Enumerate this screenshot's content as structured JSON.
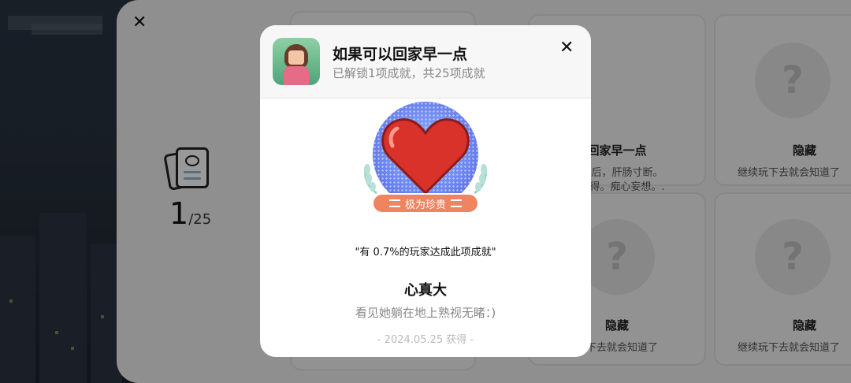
{
  "summary": {
    "unlocked": "1",
    "total": "/25"
  },
  "background_cards": [
    {
      "title": "回家早一点",
      "desc": "落花后，肝肠寸断。",
      "desc2": "求不得。痴心妄想。.",
      "tag": "极为珍贵"
    },
    {
      "title": "隐藏",
      "desc": "继续玩下去就会知道了"
    },
    {
      "title": "隐藏",
      "desc": "玩下去就会知道了"
    },
    {
      "title": "隐藏",
      "desc": "继续玩下去就会知道了"
    }
  ],
  "modal": {
    "title": "如果可以回家早一点",
    "subtitle": "已解锁1项成就，共25项成就",
    "rarity_label": "极为珍贵",
    "percent_text": "\"有 0.7%的玩家达成此项成就\"",
    "achievement_title": "心真大",
    "achievement_desc": "看见她躺在地上熟视无睹：)",
    "date": "- 2024.05.25 获得 -",
    "badge_icon": "heart-icon"
  },
  "colors": {
    "accent": "#ef8560",
    "heart": "#d8322a",
    "badge_bg": "#6f86f0"
  }
}
